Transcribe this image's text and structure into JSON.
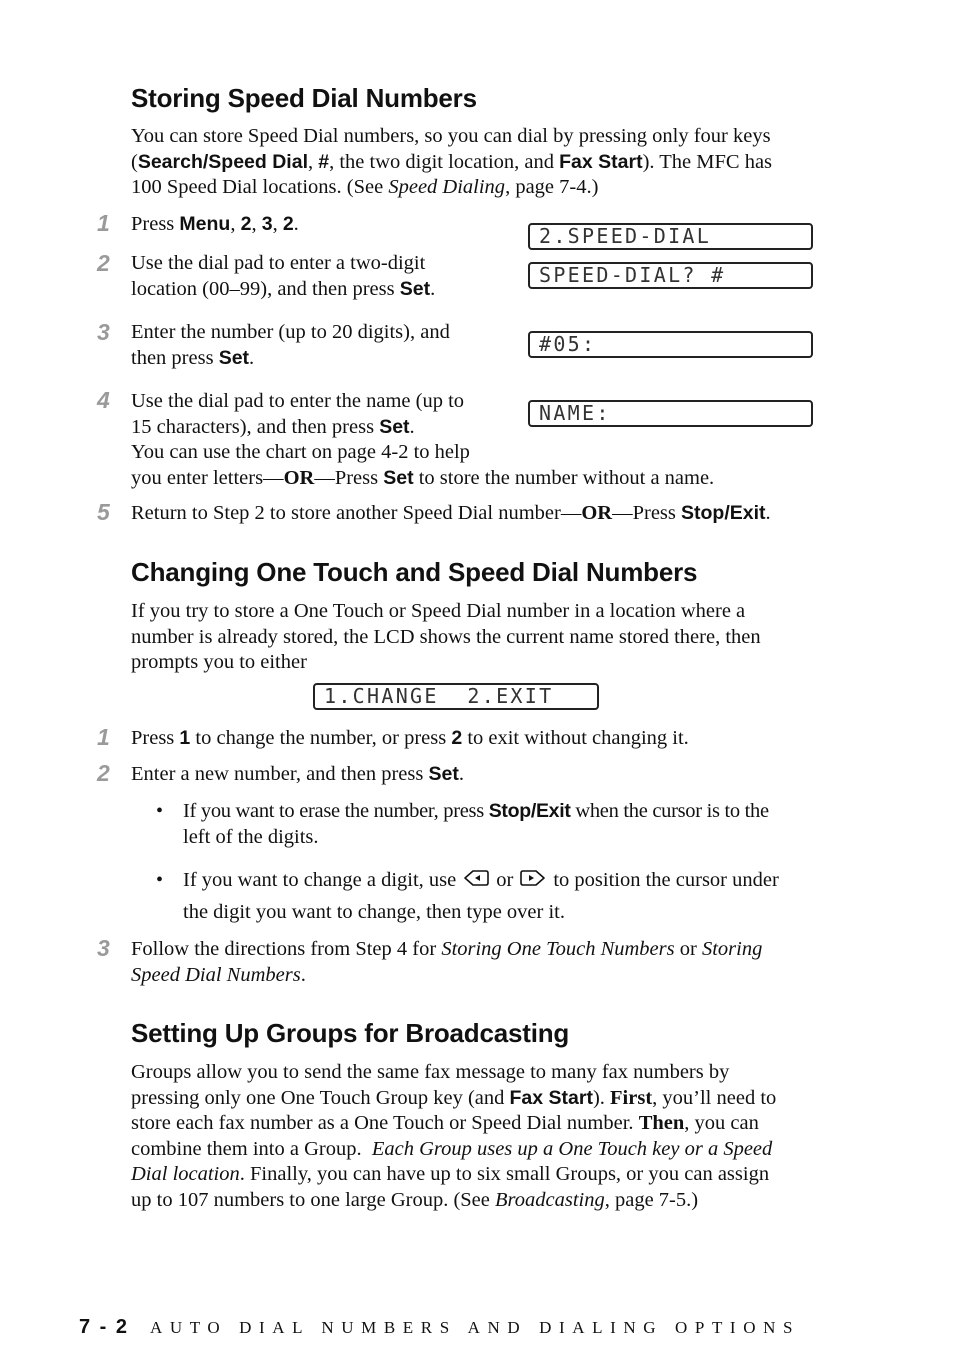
{
  "section1": {
    "title": "Storing Speed Dial Numbers",
    "intro": {
      "l1": "You can store Speed Dial numbers, so you can dial by pressing only four keys",
      "l2a": "(",
      "l2b": "Search/Speed Dial",
      "l2c": ", ",
      "l2d": "#",
      "l2e": ", the two digit location, and ",
      "l2f": "Fax Start",
      "l2g": "). The MFC has",
      "l3a": "100 Speed Dial locations. (See ",
      "l3b": "Speed Dialing",
      "l3c": ", page 7-4.)"
    },
    "steps": [
      {
        "num": "1",
        "a": "Press ",
        "b": "Menu",
        "c": ", ",
        "d": "2",
        "e": ", ",
        "f": "3",
        "g": ", ",
        "h": "2",
        "i": "."
      },
      {
        "num": "2",
        "l1": "Use the dial pad to enter a two-digit",
        "l2a": "location (00–99), and then press ",
        "l2b": "Set",
        "l2c": "."
      },
      {
        "num": "3",
        "l1": "Enter the number (up to 20 digits), and",
        "l2a": "then press ",
        "l2b": "Set",
        "l2c": "."
      },
      {
        "num": "4",
        "l1": "Use the dial pad to enter the name (up to",
        "l2a": "15 characters), and then press ",
        "l2b": "Set",
        "l2c": ".",
        "l3": "You can use the chart on page 4-2 to help",
        "l4a": "you enter letters—",
        "l4b": "OR",
        "l4c": "—Press ",
        "l4d": "Set",
        "l4e": " to store the number without a name."
      },
      {
        "num": "5",
        "a": "Return to Step 2 to store another Speed Dial number—",
        "b": "OR",
        "c": "—Press ",
        "d": "Stop/Exit",
        "e": "."
      }
    ],
    "lcd": [
      "2.SPEED-DIAL",
      "SPEED-DIAL? #",
      "#05:",
      "NAME:"
    ]
  },
  "section2": {
    "title": "Changing One Touch and Speed Dial Numbers",
    "intro": {
      "l1": "If you try to store a One Touch or Speed Dial number in a location where a",
      "l2": "number is already stored, the LCD shows the current name stored there, then",
      "l3": "prompts you to either"
    },
    "lcd": "1.CHANGE  2.EXIT",
    "steps": [
      {
        "num": "1",
        "a": "Press ",
        "b": "1",
        "c": " to change the number, or press ",
        "d": "2",
        "e": " to exit without changing it."
      },
      {
        "num": "2",
        "a": "Enter a new number, and then press ",
        "b": "Set",
        "c": "."
      },
      {
        "num": "3",
        "l1a": "Follow the directions from Step 4 for ",
        "l1b": "Storing One Touch Numbers",
        "l1c": " or ",
        "l1d": "Storing",
        "l2a": "Speed Dial Numbers",
        "l2b": "."
      }
    ],
    "bullets": [
      {
        "mark": "•",
        "l1a": "If you want to erase the number, press ",
        "l1b": "Stop/Exit",
        "l1c": " when the cursor is to the",
        "l2": "left of the digits."
      },
      {
        "mark": "•",
        "l1a": "If you want to change a digit, use",
        "or": "or",
        "l1c": "to position the cursor under",
        "l2": "the digit you want to change, then type over it.",
        "icon_left": "left-arrow-key-icon",
        "icon_right": "right-arrow-key-icon"
      }
    ]
  },
  "section3": {
    "title": "Setting Up Groups for Broadcasting",
    "body": {
      "l1": "Groups allow you to send the same fax message to many fax numbers by",
      "l2a": "pressing only one One Touch Group key (and ",
      "l2b": "Fax Start",
      "l2c": "). ",
      "l2d": "First",
      "l2e": ", you’ll need to",
      "l3a": "store each fax number as a One Touch or Speed Dial number. ",
      "l3b": "Then",
      "l3c": ", you can",
      "l4a": "combine them into a Group.  ",
      "l4b": "Each Group uses up a One Touch key or a Speed",
      "l5a": "Dial location",
      "l5b": ". Finally, you can have up to six small Groups, or you can assign",
      "l6a": "up to 107 numbers to one large Group. (See ",
      "l6b": "Broadcasting",
      "l6c": ", page 7-5.)"
    }
  },
  "footer": {
    "page": "7 - 2",
    "title": "AUTO DIAL NUMBERS AND DIALING OPTIONS"
  },
  "colors": {
    "text": "#111111",
    "step_number": "#9a9a9a"
  }
}
